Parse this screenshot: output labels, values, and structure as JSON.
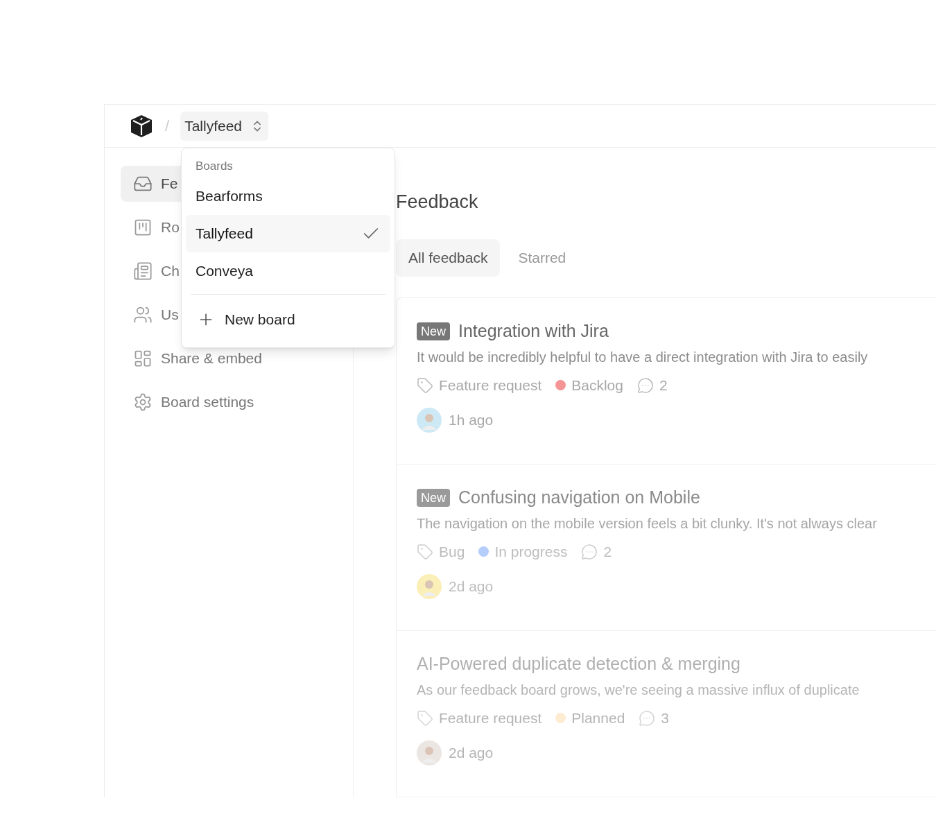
{
  "breadcrumb": {
    "separator": "/",
    "board": "Tallyfeed"
  },
  "dropdown": {
    "heading": "Boards",
    "items": [
      {
        "label": "Bearforms",
        "selected": false
      },
      {
        "label": "Tallyfeed",
        "selected": true
      },
      {
        "label": "Conveya",
        "selected": false
      }
    ],
    "action": "New board"
  },
  "sidebar": {
    "items": [
      {
        "label": "Fe",
        "selected": true
      },
      {
        "label": "Ro",
        "selected": false
      },
      {
        "label": "Ch",
        "selected": false
      },
      {
        "label": "Us",
        "selected": false
      },
      {
        "label": "Share & embed",
        "selected": false
      },
      {
        "label": "Board settings",
        "selected": false
      }
    ]
  },
  "page_title": "Feedback",
  "tabs": [
    {
      "label": "All feedback",
      "selected": true
    },
    {
      "label": "Starred",
      "selected": false
    }
  ],
  "posts": [
    {
      "badge": "New",
      "title": "Integration with Jira",
      "description": "It would be incredibly helpful to have a direct integration with Jira to easily",
      "category": "Feature request",
      "status": "Backlog",
      "color": "#f49494",
      "comments": "2",
      "time": "1h ago"
    },
    {
      "badge": "New",
      "title": "Confusing navigation on Mobile",
      "description": "The navigation on the mobile version feels a bit clunky. It's not always clear",
      "category": "Bug",
      "status": "In progress",
      "color": "#b4cdfb",
      "comments": "2",
      "time": "2d ago"
    },
    {
      "title": "AI-Powered duplicate detection & merging",
      "description": "As our feedback board grows, we're seeing a massive influx of duplicate",
      "category": "Feature request",
      "status": "Planned",
      "color": "#fdebd2",
      "comments": "3",
      "time": "2d ago"
    }
  ]
}
